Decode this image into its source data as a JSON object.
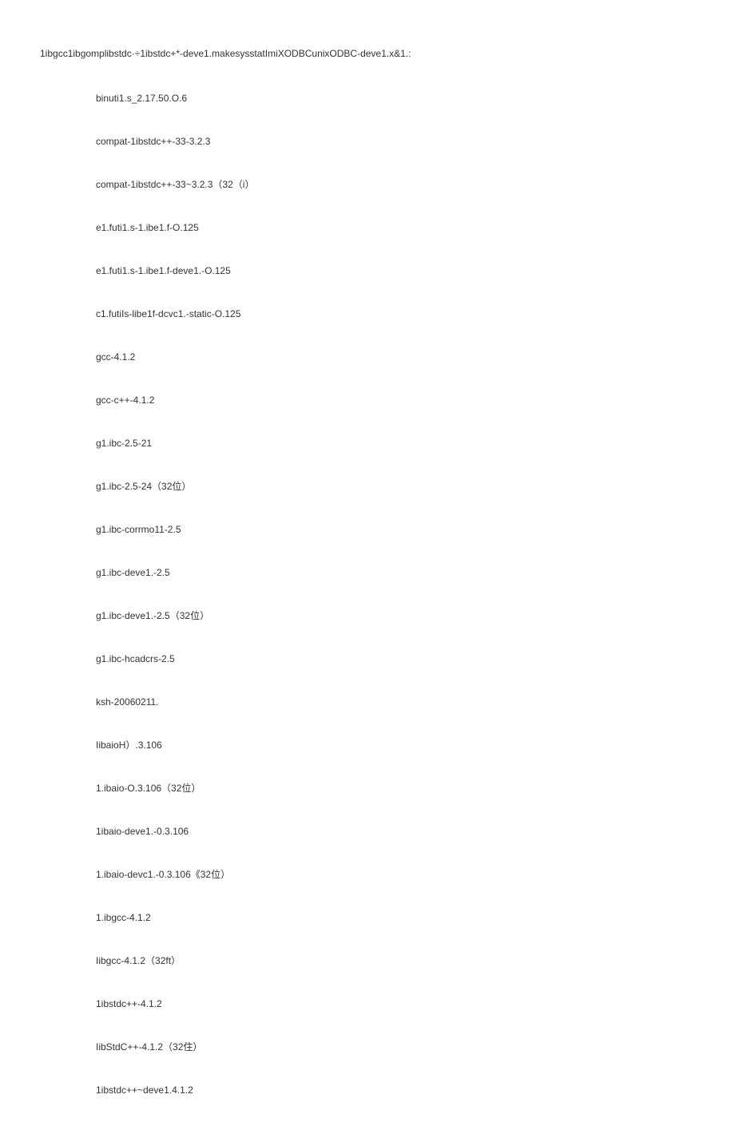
{
  "header": "1ibgcc1ibgomplibstdc·÷1ibstdc+*-deve1.makesysstatImiXODBCunixODBC-deve1.x&1.:",
  "items": [
    "binuti1.s_2.17.50.O.6",
    "compat-1ibstdc++-33-3.2.3",
    "compat-1ibstdc++-33~3.2.3（32（i）",
    "e1.futi1.s-1.ibe1.f-O.125",
    "e1.futi1.s-1.ibe1.f-deve1.-O.125",
    "c1.futiIs-libe1f-dcvc1.-static-O.125",
    "gcc-4.1.2",
    "gcc-c++-4.1.2",
    "g1.ibc-2.5-21",
    "g1.ibc-2.5-24（32位）",
    "g1.ibc-corrmo11-2.5",
    "g1.ibc-deve1.-2.5",
    "g1.ibc-deve1.-2.5（32位）",
    "g1.ibc-hcadcrs-2.5",
    "ksh-20060211.",
    "IibaioH）.3.106",
    "1.ibaio-O.3.106（32位）",
    "1ibaio-deve1.-0.3.106",
    "1.ibaio-devc1.-0.3.106《32位）",
    "1.ibgcc-4.1.2",
    "Iibgcc-4.1.2（32ft）",
    "1ibstdc++-4.1.2",
    "IibStdC++-4.1.2（32住）",
    "1ibstdc++~deve1.4.1.2"
  ]
}
